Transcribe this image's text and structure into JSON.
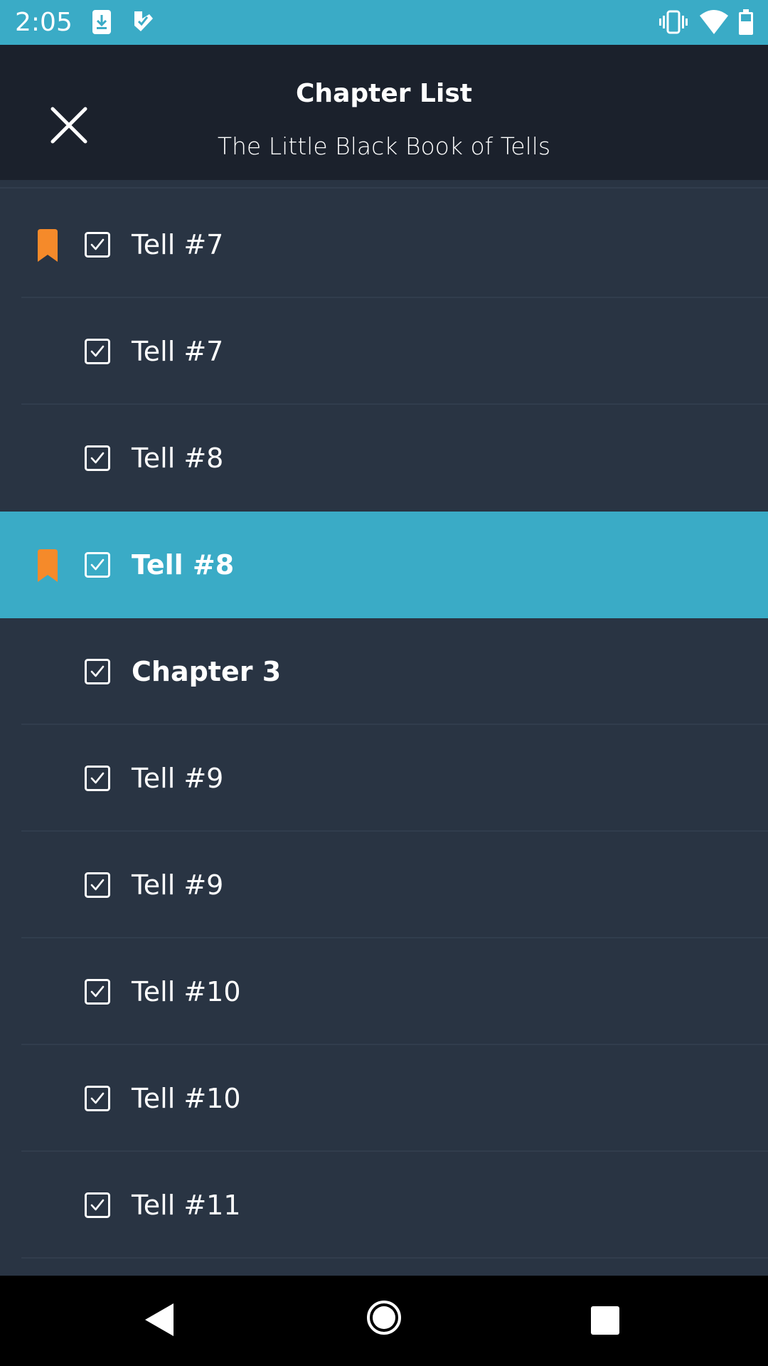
{
  "status_bar": {
    "time": "2:05",
    "icons": [
      "download-icon",
      "play-store-icon",
      "vibrate-icon",
      "wifi-icon",
      "battery-icon"
    ]
  },
  "header": {
    "title": "Chapter List",
    "subtitle": "The Little Black Book of Tells",
    "close_icon": "close-icon"
  },
  "colors": {
    "status_bar": "#3aabc6",
    "header": "#1b212c",
    "list_background": "#293443",
    "selected_row": "#3aabc6",
    "bookmark": "#f58a2a",
    "nav_bar": "#000000"
  },
  "chapters": [
    {
      "label": "Tell #7",
      "bookmarked": true,
      "checked": true,
      "bold": false,
      "selected": false
    },
    {
      "label": "Tell #7",
      "bookmarked": false,
      "checked": true,
      "bold": false,
      "selected": false
    },
    {
      "label": "Tell #8",
      "bookmarked": false,
      "checked": true,
      "bold": false,
      "selected": false
    },
    {
      "label": "Tell #8",
      "bookmarked": true,
      "checked": true,
      "bold": true,
      "selected": true
    },
    {
      "label": "Chapter 3",
      "bookmarked": false,
      "checked": true,
      "bold": true,
      "selected": false
    },
    {
      "label": "Tell #9",
      "bookmarked": false,
      "checked": true,
      "bold": false,
      "selected": false
    },
    {
      "label": "Tell #9",
      "bookmarked": false,
      "checked": true,
      "bold": false,
      "selected": false
    },
    {
      "label": "Tell #10",
      "bookmarked": false,
      "checked": true,
      "bold": false,
      "selected": false
    },
    {
      "label": "Tell #10",
      "bookmarked": false,
      "checked": true,
      "bold": false,
      "selected": false
    },
    {
      "label": "Tell #11",
      "bookmarked": false,
      "checked": true,
      "bold": false,
      "selected": false
    }
  ],
  "nav_bar": {
    "icons": [
      "back-icon",
      "home-icon",
      "recents-icon"
    ]
  }
}
